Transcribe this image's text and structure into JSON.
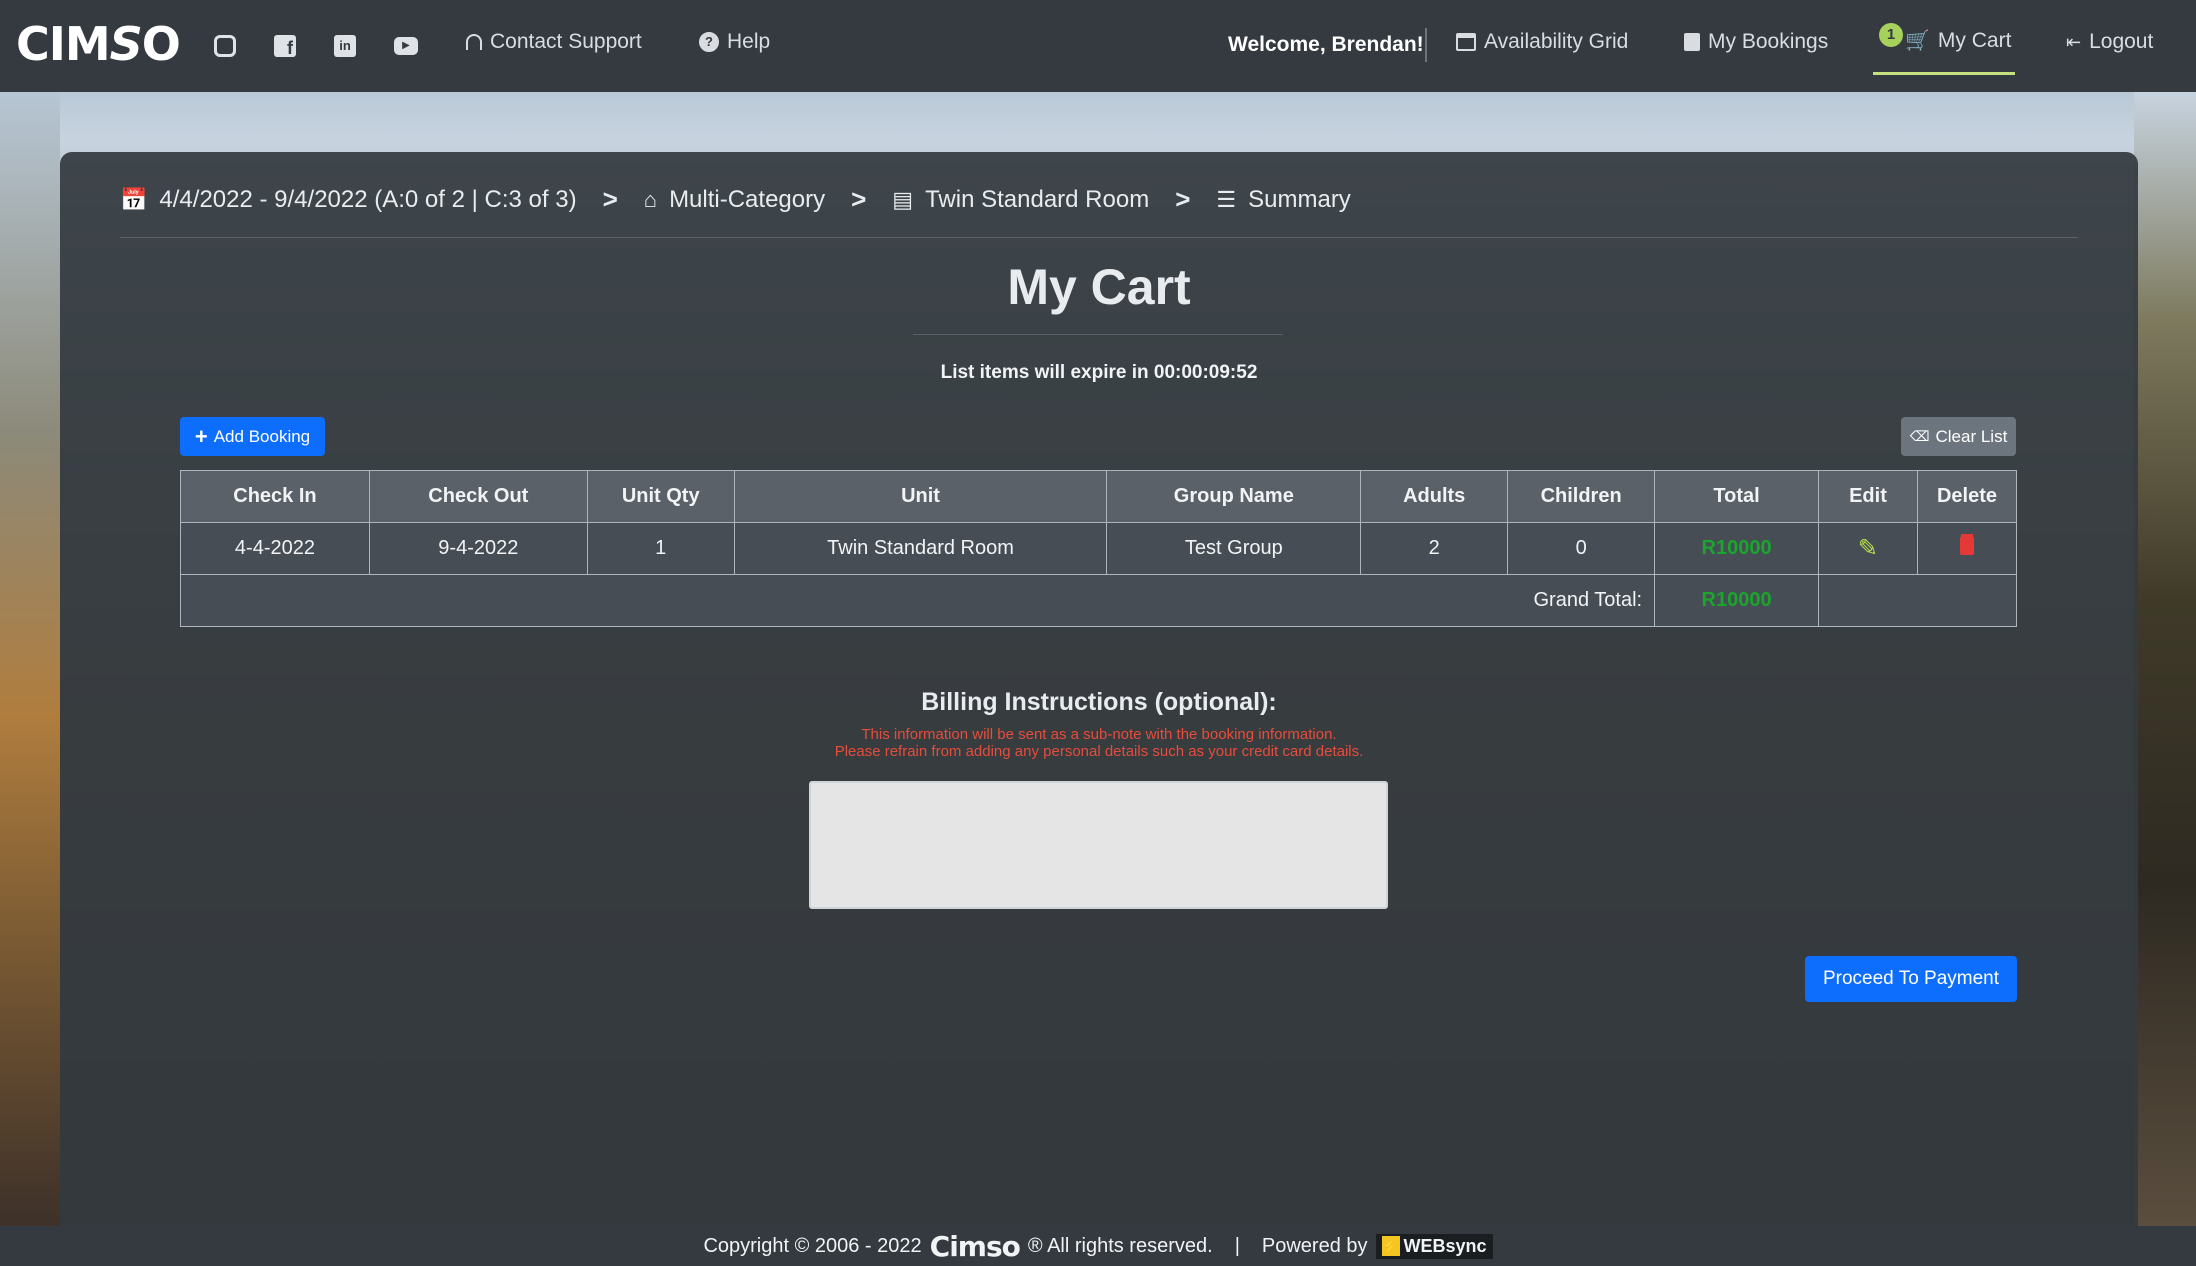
{
  "nav": {
    "brand": "Cimso",
    "contact_support": "Contact Support",
    "help": "Help",
    "welcome": "Welcome, Brendan!",
    "availability_grid": "Availability Grid",
    "my_bookings": "My Bookings",
    "cart_badge": "1",
    "my_cart": "My Cart",
    "logout": "Logout",
    "social_icons": [
      "instagram-icon",
      "facebook-icon",
      "linkedin-icon",
      "youtube-icon"
    ]
  },
  "breadcrumb": {
    "dates": "4/4/2022 - 9/4/2022 (A:0 of 2 | C:3 of 3)",
    "sep": ">",
    "category": "Multi-Category",
    "unit": "Twin Standard Room",
    "summary": "Summary"
  },
  "page": {
    "title": "My Cart",
    "expire_text": "List items will expire in 00:00:09:52",
    "add_booking": "Add Booking",
    "clear_list": "Clear List"
  },
  "table": {
    "headers": [
      "Check In",
      "Check Out",
      "Unit Qty",
      "Unit",
      "Group Name",
      "Adults",
      "Children",
      "Total",
      "Edit",
      "Delete"
    ],
    "rows": [
      {
        "check_in": "4-4-2022",
        "check_out": "9-4-2022",
        "unit_qty": "1",
        "unit": "Twin Standard Room",
        "group_name": "Test Group",
        "adults": "2",
        "children": "0",
        "total": "R10000"
      }
    ],
    "grand_total_label": "Grand Total:",
    "grand_total": "R10000",
    "total_color": "#1aa52c"
  },
  "billing": {
    "heading": "Billing Instructions (optional):",
    "note_line1": "This information will be sent as a sub-note with the booking information.",
    "note_line2": "Please refrain from adding any personal details such as your credit card details.",
    "value": ""
  },
  "actions": {
    "proceed": "Proceed To Payment"
  },
  "footer": {
    "copyright": "Copyright © 2006 - 2022",
    "brand": "Cimso",
    "rights": "® All rights reserved.",
    "pipe": "|",
    "powered_by": "Powered by",
    "websync": "WEBsync"
  },
  "colors": {
    "nav_bg": "#343a40",
    "primary": "#0d6efd",
    "secondary": "#6c757d",
    "danger": "#e74c3c",
    "accent": "#a5d15c"
  }
}
